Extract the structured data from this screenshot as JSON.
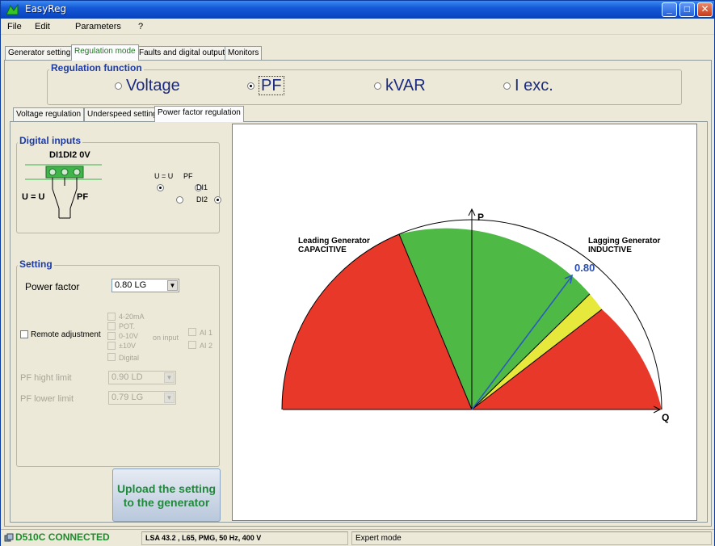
{
  "window": {
    "title": "EasyReg"
  },
  "menu": [
    "File",
    "Edit",
    "Parameters",
    "?"
  ],
  "main_tabs": [
    "Generator setting",
    "Regulation mode",
    "Faults and digital outputs",
    "Monitors"
  ],
  "regulation_function": {
    "title": "Regulation function",
    "options": [
      "Voltage",
      "PF",
      "kVAR",
      "I exc."
    ],
    "selected": "PF"
  },
  "sub_tabs": [
    "Voltage regulation",
    "Underspeed setting",
    "Power factor regulation"
  ],
  "digital_inputs": {
    "title": "Digital inputs",
    "terminal_label": "DI1DI2 0V",
    "left_label": "U = U",
    "right_label": "PF",
    "col_headers": [
      "U = U",
      "PF"
    ],
    "rows": [
      "DI1",
      "DI2"
    ]
  },
  "setting": {
    "title": "Setting",
    "power_factor_label": "Power factor",
    "power_factor_value": "0.80 LG",
    "remote_adjustment_label": "Remote adjustment",
    "input_options": [
      "4-20mA",
      "POT.",
      "0-10V",
      "±10V",
      "Digital"
    ],
    "on_input_label": "on input",
    "ai_options": [
      "AI 1",
      "AI 2"
    ],
    "pf_high_limit_label": "PF hight limit",
    "pf_high_limit_value": "0.90 LD",
    "pf_lower_limit_label": "PF lower limit",
    "pf_lower_limit_value": "0.79 LG"
  },
  "upload_button": {
    "label_line1": "Upload the setting",
    "label_line2": "to the generator"
  },
  "diagram": {
    "leading_title": "Leading Generator",
    "leading_sub": "CAPACITIVE",
    "lagging_title": "Lagging Generator",
    "lagging_sub": "INDUCTIVE",
    "axis_p": "P",
    "axis_q": "Q",
    "pf_value_label": "0.80",
    "colors": {
      "red": "#e8382a",
      "green": "#4fb946",
      "yellow": "#e6e83c",
      "arrow": "#2a5bbf"
    }
  },
  "status": {
    "connection": "D510C CONNECTED",
    "generator": "LSA 43.2  , L65, PMG, 50 Hz, 400 V",
    "mode": "Expert mode"
  }
}
